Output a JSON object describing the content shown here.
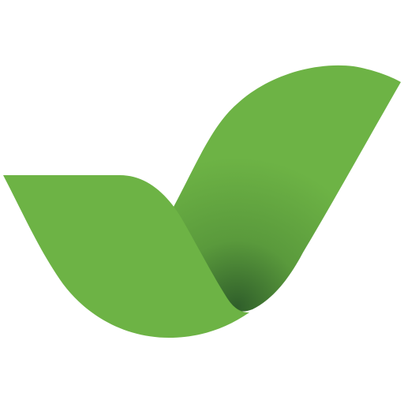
{
  "logo": {
    "icon": "leaf-checkmark-icon",
    "colors": {
      "background": "#ffffff",
      "leaf_green": "#6db345",
      "leaf_green_mid": "#5a9a3c",
      "leaf_shadow_dark": "#2f5e2a"
    }
  }
}
